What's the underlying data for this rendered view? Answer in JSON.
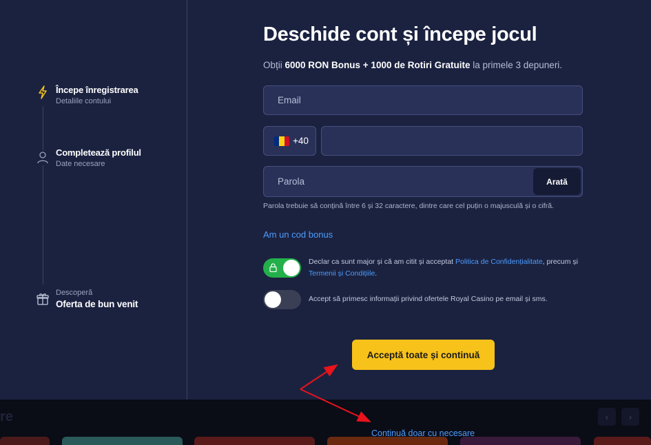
{
  "sidebar": {
    "steps": [
      {
        "title": "Începe înregistrarea",
        "subtitle": "Detaliile contului",
        "icon": "lightning-icon"
      },
      {
        "title": "Completează profilul",
        "subtitle": "Date necesare",
        "icon": "user-icon"
      },
      {
        "title": "Oferta de bun venit",
        "subtitle": "Descoperă",
        "icon": "gift-icon"
      }
    ]
  },
  "form": {
    "title": "Deschide cont și începe jocul",
    "subtitle_pre": "Obții ",
    "subtitle_bold": "6000 RON Bonus + 1000 de Rotiri Gratuite",
    "subtitle_post": " la primele 3 depuneri.",
    "email_placeholder": "Email",
    "phone_prefix": "+40",
    "phone_value": "",
    "password_placeholder": "Parola",
    "show_password_label": "Arată",
    "password_hint": "Parola trebuie să conțină între 6 și 32 caractere, dintre care cel puțin o majusculă și o cifră.",
    "bonus_code_link": "Am un cod bonus",
    "consent_terms": {
      "checked": true,
      "text_pre": "Declar ca sunt major și că am citit și acceptat ",
      "privacy_link": "Politica de Confidențialitate",
      "text_mid": ", precum și ",
      "terms_link": "Termenii și Condițiile",
      "text_post": "."
    },
    "consent_marketing": {
      "checked": false,
      "text": "Accept să primesc informații privind ofertele Royal Casino pe email și sms."
    },
    "accept_all_button": "Acceptă toate și continuă",
    "continue_necessary_link": "Continuă doar cu necesare"
  },
  "background": {
    "section_title": "re",
    "prev_arrow": "‹",
    "next_arrow": "›"
  },
  "colors": {
    "accent_yellow": "#f7c21a",
    "link_blue": "#4d9dff",
    "toggle_on": "#23b04a",
    "annotation_red": "#e8131b",
    "flag_blue": "#002b7f",
    "flag_yellow": "#fcd116",
    "flag_red": "#ce1126"
  }
}
